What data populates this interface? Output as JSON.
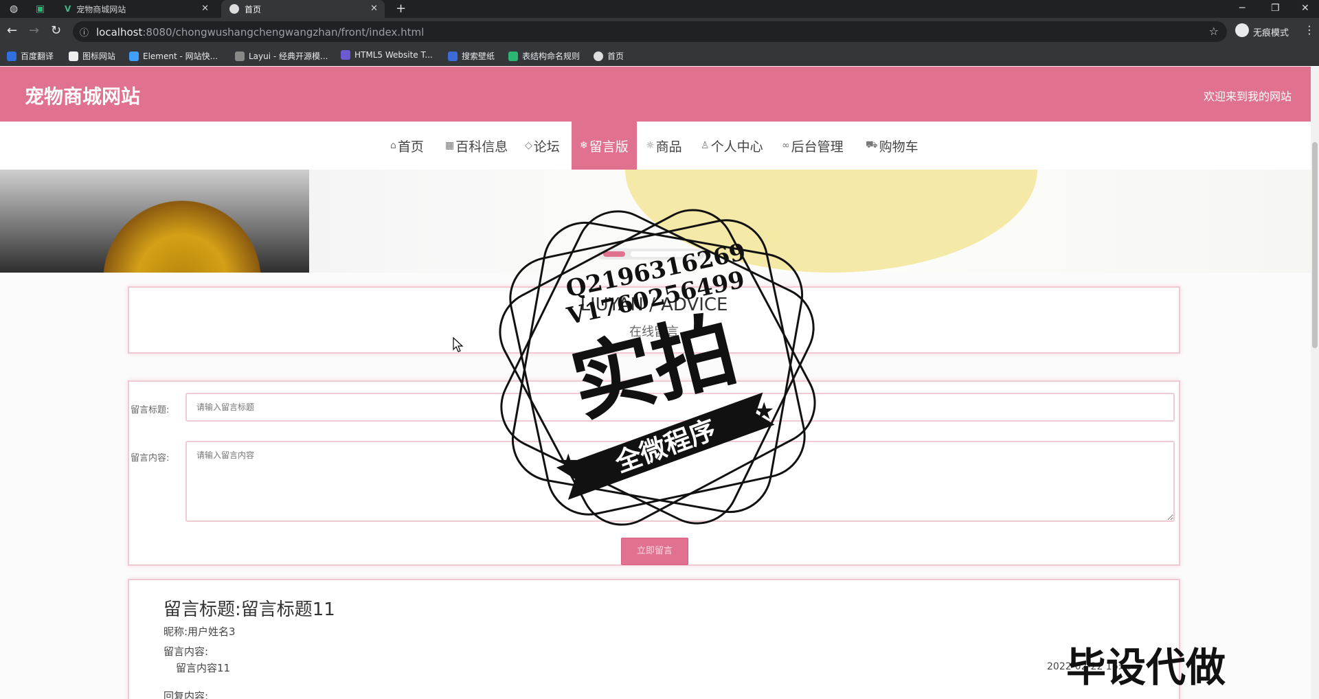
{
  "browser": {
    "tabs": [
      {
        "title": "宠物商城网站",
        "active": false
      },
      {
        "title": "首页",
        "active": true
      }
    ],
    "new_tab_symbol": "+",
    "url_host": "localhost",
    "url_rest": ":8080/chongwushangchengwangzhan/front/index.html",
    "incognito_label": "无痕模式",
    "bookmarks": [
      "百度翻译",
      "图标网站",
      "Element - 网站快...",
      "Layui - 经典开源模...",
      "HTML5 Website T...",
      "搜索壁纸",
      "表结构命名规则",
      "首页"
    ]
  },
  "header": {
    "site_title": "宠物商城网站",
    "welcome": "欢迎来到我的网站"
  },
  "nav": {
    "items": [
      {
        "label": "首页",
        "icon": "home-icon",
        "glyph": "⌂"
      },
      {
        "label": "百科信息",
        "icon": "grid-icon",
        "glyph": "▦"
      },
      {
        "label": "论坛",
        "icon": "tag-icon",
        "glyph": "◇"
      },
      {
        "label": "留言版",
        "icon": "snowflake-icon",
        "glyph": "❄",
        "active": true
      },
      {
        "label": "商品",
        "icon": "sun-icon",
        "glyph": "☼"
      },
      {
        "label": "个人中心",
        "icon": "user-icon",
        "glyph": "♙"
      },
      {
        "label": "后台管理",
        "icon": "link-icon",
        "glyph": "∞"
      },
      {
        "label": "购物车",
        "icon": "cart-icon",
        "glyph": "⛟"
      }
    ],
    "active_color": "#e0728f"
  },
  "section": {
    "title_en": "LIUYAN / ADVICE",
    "title_cn": "在线留言"
  },
  "form": {
    "title_label": "留言标题:",
    "title_placeholder": "请输入留言标题",
    "content_label": "留言内容:",
    "content_placeholder": "请输入留言内容",
    "submit_label": "立即留言"
  },
  "message": {
    "title_prefix": "留言标题:",
    "title_value": "留言标题11",
    "nickname": "昵称:用户姓名3",
    "content_label": "留言内容:",
    "content_value": "留言内容11",
    "reply_label": "回复内容:",
    "time": "2022-02-22 16:..."
  },
  "watermark": {
    "qq1": "Q2196316269",
    "qq2": "V1760256499",
    "big": "实拍",
    "ribbon": "全微程序",
    "bottom": "毕设代做"
  },
  "theme": {
    "primary": "#e0728f",
    "border": "#f1c9d3"
  }
}
